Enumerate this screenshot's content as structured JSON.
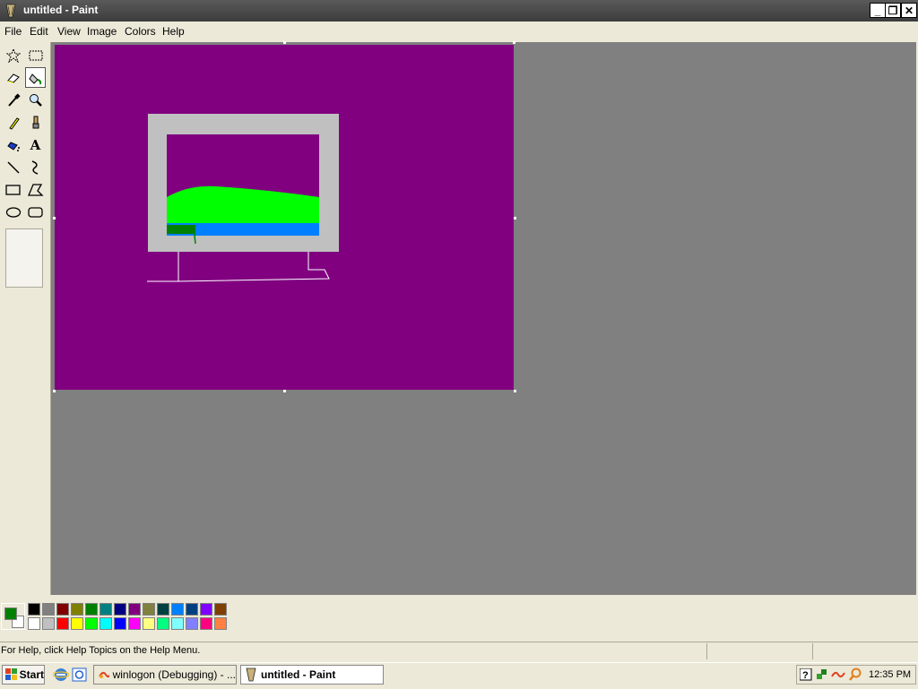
{
  "window": {
    "title": "untitled - Paint",
    "controls": {
      "minimize": "_",
      "restore": "❐",
      "close": "✕"
    }
  },
  "menu": [
    "File",
    "Edit",
    "View",
    "Image",
    "Colors",
    "Help"
  ],
  "tools": [
    {
      "name": "free-form-select-tool",
      "icon": "star-select-icon"
    },
    {
      "name": "select-tool",
      "icon": "rect-select-icon"
    },
    {
      "name": "eraser-tool",
      "icon": "eraser-icon"
    },
    {
      "name": "fill-tool",
      "icon": "paint-bucket-icon",
      "selected": true
    },
    {
      "name": "pick-color-tool",
      "icon": "eyedropper-icon"
    },
    {
      "name": "magnifier-tool",
      "icon": "magnifier-icon"
    },
    {
      "name": "pencil-tool",
      "icon": "pencil-icon"
    },
    {
      "name": "brush-tool",
      "icon": "brush-icon"
    },
    {
      "name": "airbrush-tool",
      "icon": "airbrush-icon"
    },
    {
      "name": "text-tool",
      "icon": "text-icon",
      "label": "A"
    },
    {
      "name": "line-tool",
      "icon": "line-icon"
    },
    {
      "name": "curve-tool",
      "icon": "curve-icon"
    },
    {
      "name": "rectangle-tool",
      "icon": "rectangle-icon"
    },
    {
      "name": "polygon-tool",
      "icon": "polygon-icon"
    },
    {
      "name": "ellipse-tool",
      "icon": "ellipse-icon"
    },
    {
      "name": "rounded-rectangle-tool",
      "icon": "rounded-rect-icon"
    }
  ],
  "palette": {
    "foreground": "#008000",
    "background": "#ffffff",
    "row1": [
      "#000000",
      "#808080",
      "#800000",
      "#808000",
      "#008000",
      "#008080",
      "#000080",
      "#800080",
      "#808040",
      "#004040",
      "#0080ff",
      "#004080",
      "#8000ff",
      "#804000"
    ],
    "row2": [
      "#ffffff",
      "#c0c0c0",
      "#ff0000",
      "#ffff00",
      "#00ff00",
      "#00ffff",
      "#0000ff",
      "#ff00ff",
      "#ffff80",
      "#00ff80",
      "#80ffff",
      "#8080ff",
      "#ff0080",
      "#ff8040"
    ]
  },
  "canvas": {
    "background": "#800080",
    "frame_color": "#c0c0c0",
    "screen_color": "#800080",
    "hill_color": "#00ff00",
    "water_color": "#0080ff",
    "dark_green": "#008000",
    "stand_color": "#ffffff"
  },
  "status": {
    "text": "For Help, click Help Topics on the Help Menu."
  },
  "taskbar": {
    "start_label": "Start",
    "buttons": [
      {
        "label": "winlogon (Debugging) - ...",
        "icon": "debugger-icon",
        "active": false
      },
      {
        "label": "untitled - Paint",
        "icon": "paint-icon",
        "active": true
      }
    ],
    "quick_launch": [
      "ie-icon",
      "outlook-icon"
    ],
    "tray_icons": [
      "help-icon",
      "network-icon",
      "debug-tray-icon",
      "search-icon"
    ],
    "clock": "12:35 PM"
  }
}
